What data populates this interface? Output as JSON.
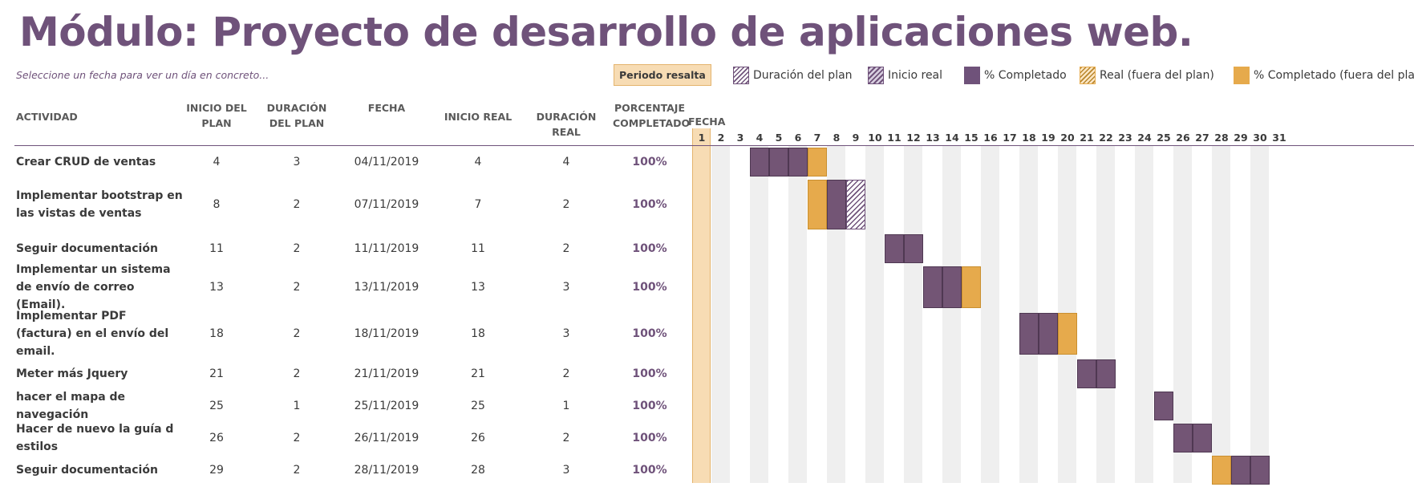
{
  "title": "Módulo: Proyecto de desarrollo de aplicaciones web.",
  "hint": "Seleccione un fecha para ver un día en concreto...",
  "period": {
    "label": "Periodo resalta",
    "value": "1"
  },
  "legend": [
    {
      "key": "plan",
      "label": "Duración del plan"
    },
    {
      "key": "real",
      "label": "Inicio real"
    },
    {
      "key": "done",
      "label": "% Completado"
    },
    {
      "key": "out",
      "label": "Real (fuera del plan)"
    },
    {
      "key": "outdone",
      "label": "% Completado (fuera del plan)"
    }
  ],
  "headers": {
    "actividad": "ACTIVIDAD",
    "inicio_plan": "INICIO DEL PLAN",
    "duracion_plan": "DURACIÓN DEL PLAN",
    "fecha": "FECHA",
    "inicio_real": "INICIO REAL",
    "duracion_real": "DURACIÓN REAL",
    "porcentaje": "PORCENTAJE COMPLETADO",
    "fecha_axis": "FECHA"
  },
  "highlighted_day": 1,
  "days": [
    1,
    2,
    3,
    4,
    5,
    6,
    7,
    8,
    9,
    10,
    11,
    12,
    13,
    14,
    15,
    16,
    17,
    18,
    19,
    20,
    21,
    22,
    23,
    24,
    25,
    26,
    27,
    28,
    29,
    30,
    31
  ],
  "colors": {
    "accent": "#6f527a",
    "orange": "#e6aa4c",
    "highlight": "#f7dcb4"
  },
  "rows": [
    {
      "actividad": "Crear CRUD de ventas",
      "inicio_plan": 4,
      "duracion_plan": 3,
      "fecha": "04/11/2019",
      "inicio_real": 4,
      "duracion_real": 4,
      "porcentaje": "100%"
    },
    {
      "actividad": "Implementar bootstrap en las vistas de ventas",
      "inicio_plan": 8,
      "duracion_plan": 2,
      "fecha": "07/11/2019",
      "inicio_real": 7,
      "duracion_real": 2,
      "porcentaje": "100%"
    },
    {
      "actividad": "Seguir documentación",
      "inicio_plan": 11,
      "duracion_plan": 2,
      "fecha": "11/11/2019",
      "inicio_real": 11,
      "duracion_real": 2,
      "porcentaje": "100%"
    },
    {
      "actividad": "Implementar un sistema de envío de correo (Email).",
      "inicio_plan": 13,
      "duracion_plan": 2,
      "fecha": "13/11/2019",
      "inicio_real": 13,
      "duracion_real": 3,
      "porcentaje": "100%"
    },
    {
      "actividad": "Implementar PDF (factura) en el envío del email.",
      "inicio_plan": 18,
      "duracion_plan": 2,
      "fecha": "18/11/2019",
      "inicio_real": 18,
      "duracion_real": 3,
      "porcentaje": "100%"
    },
    {
      "actividad": "Meter más Jquery",
      "inicio_plan": 21,
      "duracion_plan": 2,
      "fecha": "21/11/2019",
      "inicio_real": 21,
      "duracion_real": 2,
      "porcentaje": "100%"
    },
    {
      "actividad": "hacer el mapa de navegación",
      "inicio_plan": 25,
      "duracion_plan": 1,
      "fecha": "25/11/2019",
      "inicio_real": 25,
      "duracion_real": 1,
      "porcentaje": "100%"
    },
    {
      "actividad": "Hacer de nuevo la guía d estilos",
      "inicio_plan": 26,
      "duracion_plan": 2,
      "fecha": "26/11/2019",
      "inicio_real": 26,
      "duracion_real": 2,
      "porcentaje": "100%"
    },
    {
      "actividad": "Seguir documentación",
      "inicio_plan": 29,
      "duracion_plan": 2,
      "fecha": "28/11/2019",
      "inicio_real": 28,
      "duracion_real": 3,
      "porcentaje": "100%"
    }
  ]
}
